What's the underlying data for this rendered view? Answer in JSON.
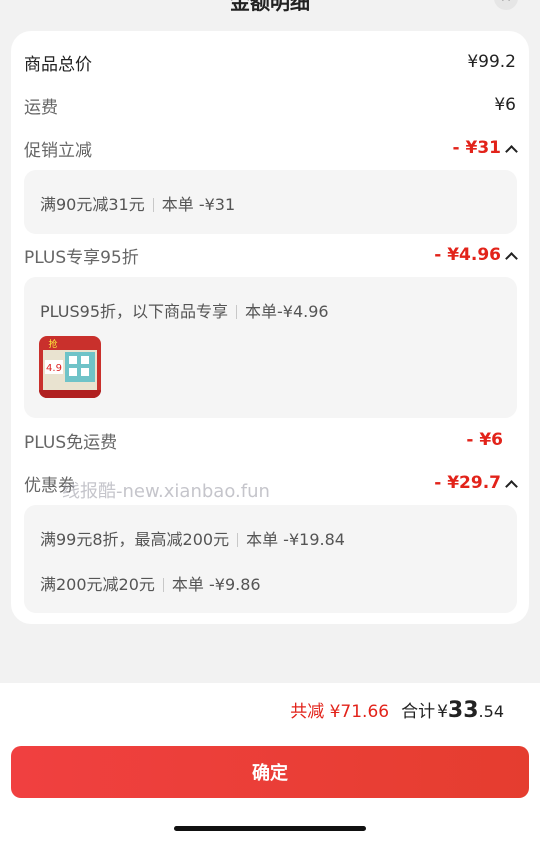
{
  "header": {
    "title": "金额明细",
    "close_icon": "close-icon"
  },
  "summary": {
    "goods_total": {
      "label": "商品总价",
      "value": "¥99.2"
    },
    "shipping": {
      "label": "运费",
      "value": "¥6"
    },
    "promo": {
      "label": "促销立减",
      "value": "- ¥31"
    },
    "promo_detail": {
      "rule": "满90元减31元",
      "order": "本单 -¥31"
    },
    "plus_discount": {
      "label": "PLUS专享95折",
      "value": "- ¥4.96"
    },
    "plus_detail": {
      "rule": "PLUS95折，以下商品专享",
      "order": "本单-¥4.96"
    },
    "plus_freeship": {
      "label": "PLUS免运费",
      "value": "- ¥6"
    },
    "coupon": {
      "label": "优惠券",
      "value": "- ¥29.7"
    },
    "coupon_details": [
      {
        "rule": "满99元8折，最高减200元",
        "order": "本单 -¥19.84"
      },
      {
        "rule": "满200元减20元",
        "order": "本单 -¥9.86"
      }
    ]
  },
  "product": {
    "thumb_badge": "4.9",
    "thumb_label": "抢"
  },
  "watermark": "线报酷-new.xianbao.fun",
  "footer": {
    "saved": "共减 ¥71.66",
    "total_label": "合计",
    "total_currency": "¥",
    "total_int": "33",
    "total_dec": ".54",
    "confirm_label": "确定"
  },
  "colors": {
    "accent": "#e2231a",
    "button": "#e8423a"
  }
}
